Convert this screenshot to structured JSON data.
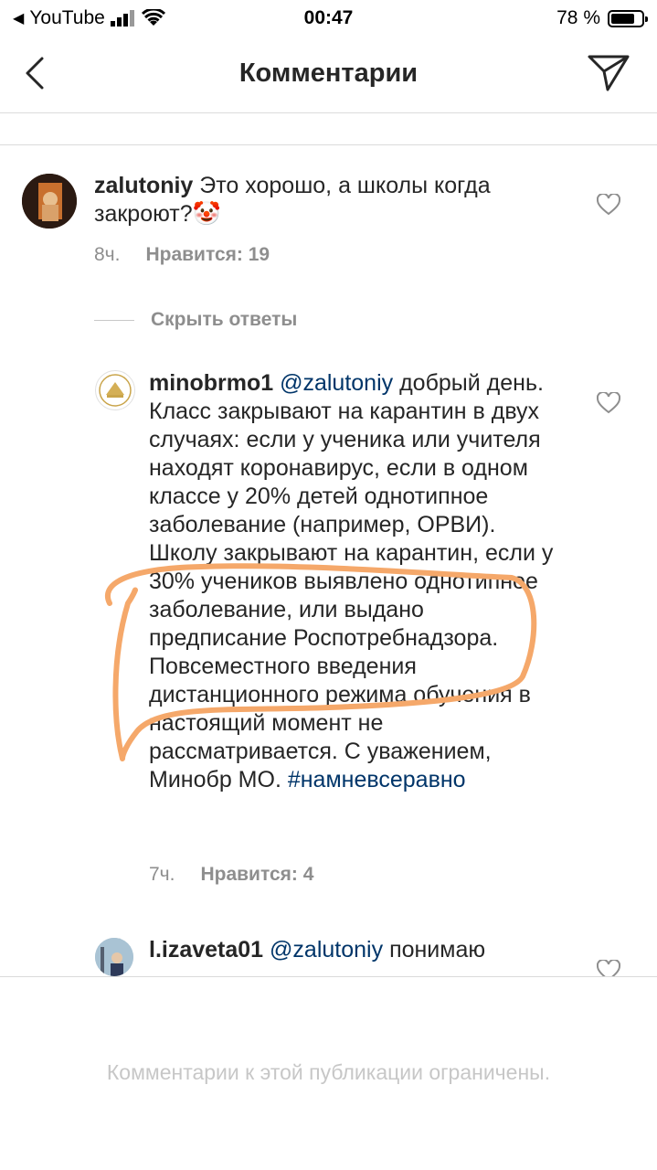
{
  "status": {
    "back_app": "YouTube",
    "time": "00:47",
    "battery": "78 %"
  },
  "header": {
    "title": "Комментарии"
  },
  "comments": [
    {
      "username": "zalutoniy",
      "text": "Это хорошо, а школы когда закроют?",
      "emoji": "🤡",
      "time": "8ч.",
      "likes": "Нравится: 19"
    }
  ],
  "replies_toggle": "Скрыть ответы",
  "replies": [
    {
      "username": "minobrmo1",
      "mention": "@zalutoniy",
      "text": "добрый день. Класс закрывают на карантин в двух случаях: если у ученика или учителя находят коронавирус, если в одном классе у 20% детей однотипное заболевание (например, ОРВИ). Школу закрывают на карантин, если у 30% учеников выявлено однотипное заболевание, или выдано предписание Роспотребнадзора. Повсеместного введения дистанционного режима обучения в настоящий момент не рассматривается. С уважением, Минобр МО.",
      "hashtag": "#намневсеравно",
      "time": "7ч.",
      "likes": "Нравится: 4"
    },
    {
      "username": "l.izaveta01",
      "mention": "@zalutoniy",
      "text": "понимаю"
    }
  ],
  "footer": {
    "restricted_text": "Комментарии к этой публикации ограничены."
  },
  "colors": {
    "annotation": "#f5a86a",
    "mention": "#003569",
    "meta": "#8e8e8e"
  }
}
